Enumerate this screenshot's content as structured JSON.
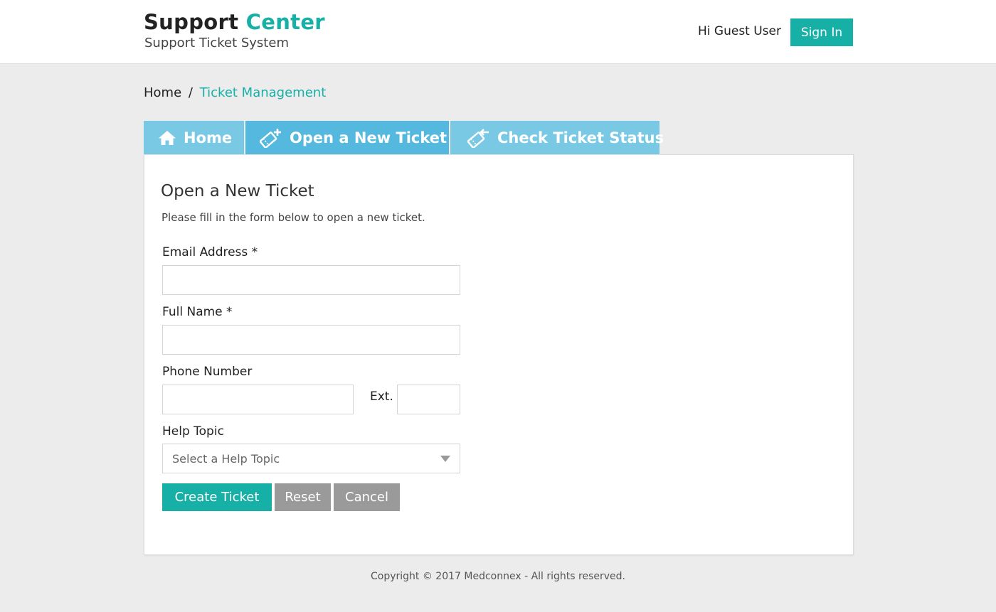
{
  "header": {
    "brand_main": "Support",
    "brand_accent": "Center",
    "subtitle": "Support Ticket System",
    "greeting": "Hi Guest User",
    "signin_label": "Sign In"
  },
  "breadcrumb": {
    "home": "Home",
    "separator": "/",
    "current": "Ticket Management"
  },
  "nav": {
    "tabs": [
      {
        "label": "Home",
        "icon": "home-icon",
        "active": false
      },
      {
        "label": "Open a New Ticket",
        "icon": "ticket-add-icon",
        "active": true
      },
      {
        "label": "Check Ticket Status",
        "icon": "ticket-status-icon",
        "active": false
      }
    ]
  },
  "form": {
    "title": "Open a New Ticket",
    "description": "Please fill in the form below to open a new ticket.",
    "email_label": "Email Address *",
    "email_value": "",
    "name_label": "Full Name *",
    "name_value": "",
    "phone_label": "Phone Number",
    "phone_value": "",
    "ext_label": "Ext.",
    "ext_value": "",
    "topic_label": "Help Topic",
    "topic_selected": "Select a Help Topic",
    "create_label": "Create Ticket",
    "reset_label": "Reset",
    "cancel_label": "Cancel"
  },
  "footer": {
    "copyright": "Copyright © 2017 Medconnex - All rights reserved."
  },
  "colors": {
    "accent": "#17b0a7",
    "tab": "#79c9e4",
    "tab_active": "#55b8de",
    "button_secondary": "#9a9a9a",
    "page_background": "#ececec"
  }
}
